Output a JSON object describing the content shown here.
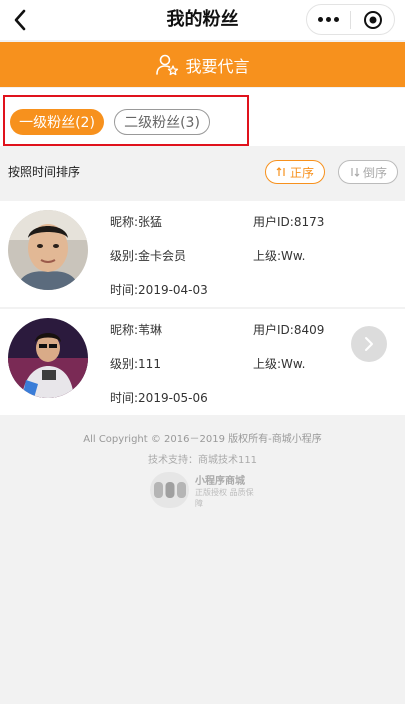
{
  "header": {
    "title": "我的粉丝"
  },
  "promo": {
    "label": "我要代言"
  },
  "tabs": [
    {
      "label": "一级粉丝(2)",
      "active": true
    },
    {
      "label": "二级粉丝(3)",
      "active": false
    }
  ],
  "sort": {
    "label": "按照时间排序",
    "asc_label": "正序",
    "desc_label": "倒序"
  },
  "fans": [
    {
      "nickname": "昵称:张猛",
      "user_id": "用户ID:8173",
      "level": "级别:金卡会员",
      "superior": "上级:Ww.",
      "time": "时间:2019-04-03"
    },
    {
      "nickname": "昵称:苇琳",
      "user_id": "用户ID:8409",
      "level": "级别:111",
      "superior": "上级:Ww.",
      "time": "时间:2019-05-06"
    }
  ],
  "footer": {
    "copyright": "All Copyright © 2016－2019 版权所有-商城小程序",
    "support": "技术支持：商城技术111",
    "logo_line1": "小程序商城",
    "logo_line2": "正版授权 品质保障"
  },
  "colors": {
    "accent": "#f7911d",
    "highlight": "#e0121c"
  }
}
